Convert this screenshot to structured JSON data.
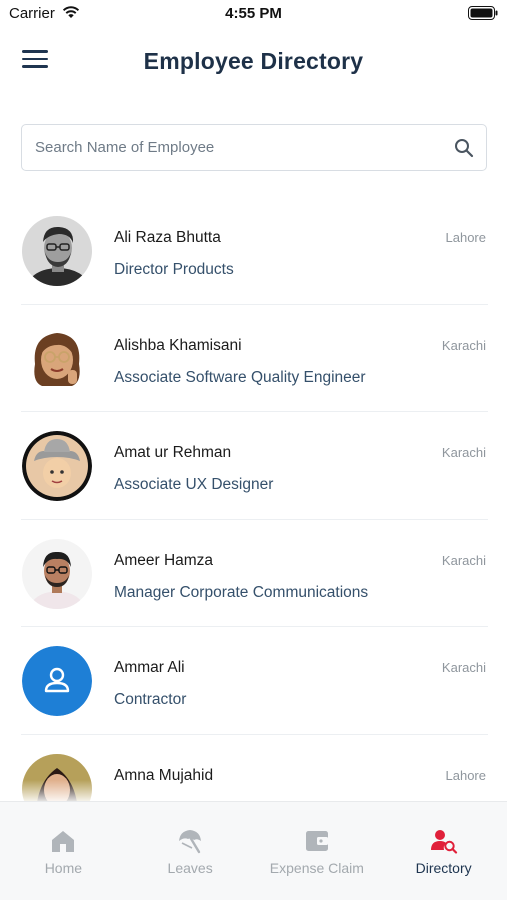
{
  "status_bar": {
    "carrier": "Carrier",
    "time": "4:55 PM"
  },
  "header": {
    "title": "Employee Directory",
    "menu_icon": "hamburger-menu-icon"
  },
  "search": {
    "placeholder": "Search Name of Employee",
    "value": "",
    "icon": "search-icon"
  },
  "employees": [
    {
      "name": "Ali Raza Bhutta",
      "title": "Director Products",
      "city": "Lahore",
      "avatar": "photo-man-glasses-beard"
    },
    {
      "name": "Alishba Khamisani",
      "title": "Associate Software Quality Engineer",
      "city": "Karachi",
      "avatar": "memoji-woman-glasses"
    },
    {
      "name": "Amat  ur Rehman",
      "title": "Associate UX Designer",
      "city": "Karachi",
      "avatar": "memoji-woman-hat"
    },
    {
      "name": "Ameer Hamza",
      "title": "Manager Corporate Communications",
      "city": "Karachi",
      "avatar": "photo-man-glasses"
    },
    {
      "name": "Ammar  Ali",
      "title": "Contractor",
      "city": "Karachi",
      "avatar": "default-user-icon"
    },
    {
      "name": "Amna Mujahid",
      "title": "",
      "city": "Lahore",
      "avatar": "photo-woman"
    }
  ],
  "tabs": [
    {
      "label": "Home",
      "icon": "home-icon",
      "active": false
    },
    {
      "label": "Leaves",
      "icon": "beach-umbrella-icon",
      "active": false
    },
    {
      "label": "Expense Claim",
      "icon": "wallet-icon",
      "active": false
    },
    {
      "label": "Directory",
      "icon": "user-search-icon",
      "active": true
    }
  ],
  "colors": {
    "title": "#1e3148",
    "job_title": "#35506b",
    "city": "#8f969d",
    "default_avatar": "#1e7fd6",
    "active_tab_icon": "#e0203a",
    "active_tab_label": "#1e3550",
    "inactive_tab": "#a3a9ae"
  }
}
